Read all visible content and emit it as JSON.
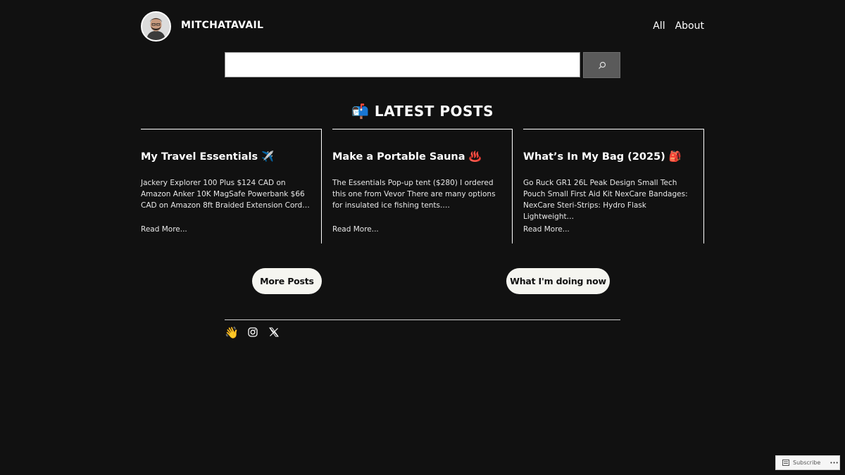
{
  "site": {
    "title": "MITCHATAVAIL",
    "avatar_icon": "avatar-photo"
  },
  "nav": {
    "items": [
      "All",
      "About"
    ]
  },
  "search": {
    "value": "",
    "placeholder": "",
    "button_icon": "search-icon"
  },
  "latest": {
    "heading": "📬 LATEST POSTS"
  },
  "posts": [
    {
      "title": "My Travel Essentials ✈️",
      "excerpt": "Jackery Explorer 100 Plus $124 CAD on Amazon Anker 10K MagSafe Powerbank $66 CAD on Amazon 8ft Braided Extension Cord…",
      "more": "Read More..."
    },
    {
      "title": "Make a Portable Sauna ♨️",
      "excerpt": "The Essentials Pop-up tent ($280) I ordered this one from Vevor There are many options for insulated ice fishing tents.…",
      "more": "Read More..."
    },
    {
      "title": "What’s In My Bag (2025) 🎒",
      "excerpt": "Go Ruck GR1 26L Peak Design Small Tech Pouch Small First Aid Kit NexCare Bandages: NexCare Steri-Strips: Hydro Flask Lightweight…",
      "more": "Read More..."
    }
  ],
  "buttons": {
    "more_posts": "More Posts",
    "now": "What I'm doing now"
  },
  "social": {
    "wave": "👋",
    "icons": [
      "instagram-icon",
      "x-icon"
    ]
  },
  "subscribe": {
    "label": "Subscribe",
    "more": "•••"
  },
  "colors": {
    "background": "#111111",
    "text": "#ffffff",
    "pill": "#f5f5f0",
    "search_button": "#5a5a5a"
  }
}
